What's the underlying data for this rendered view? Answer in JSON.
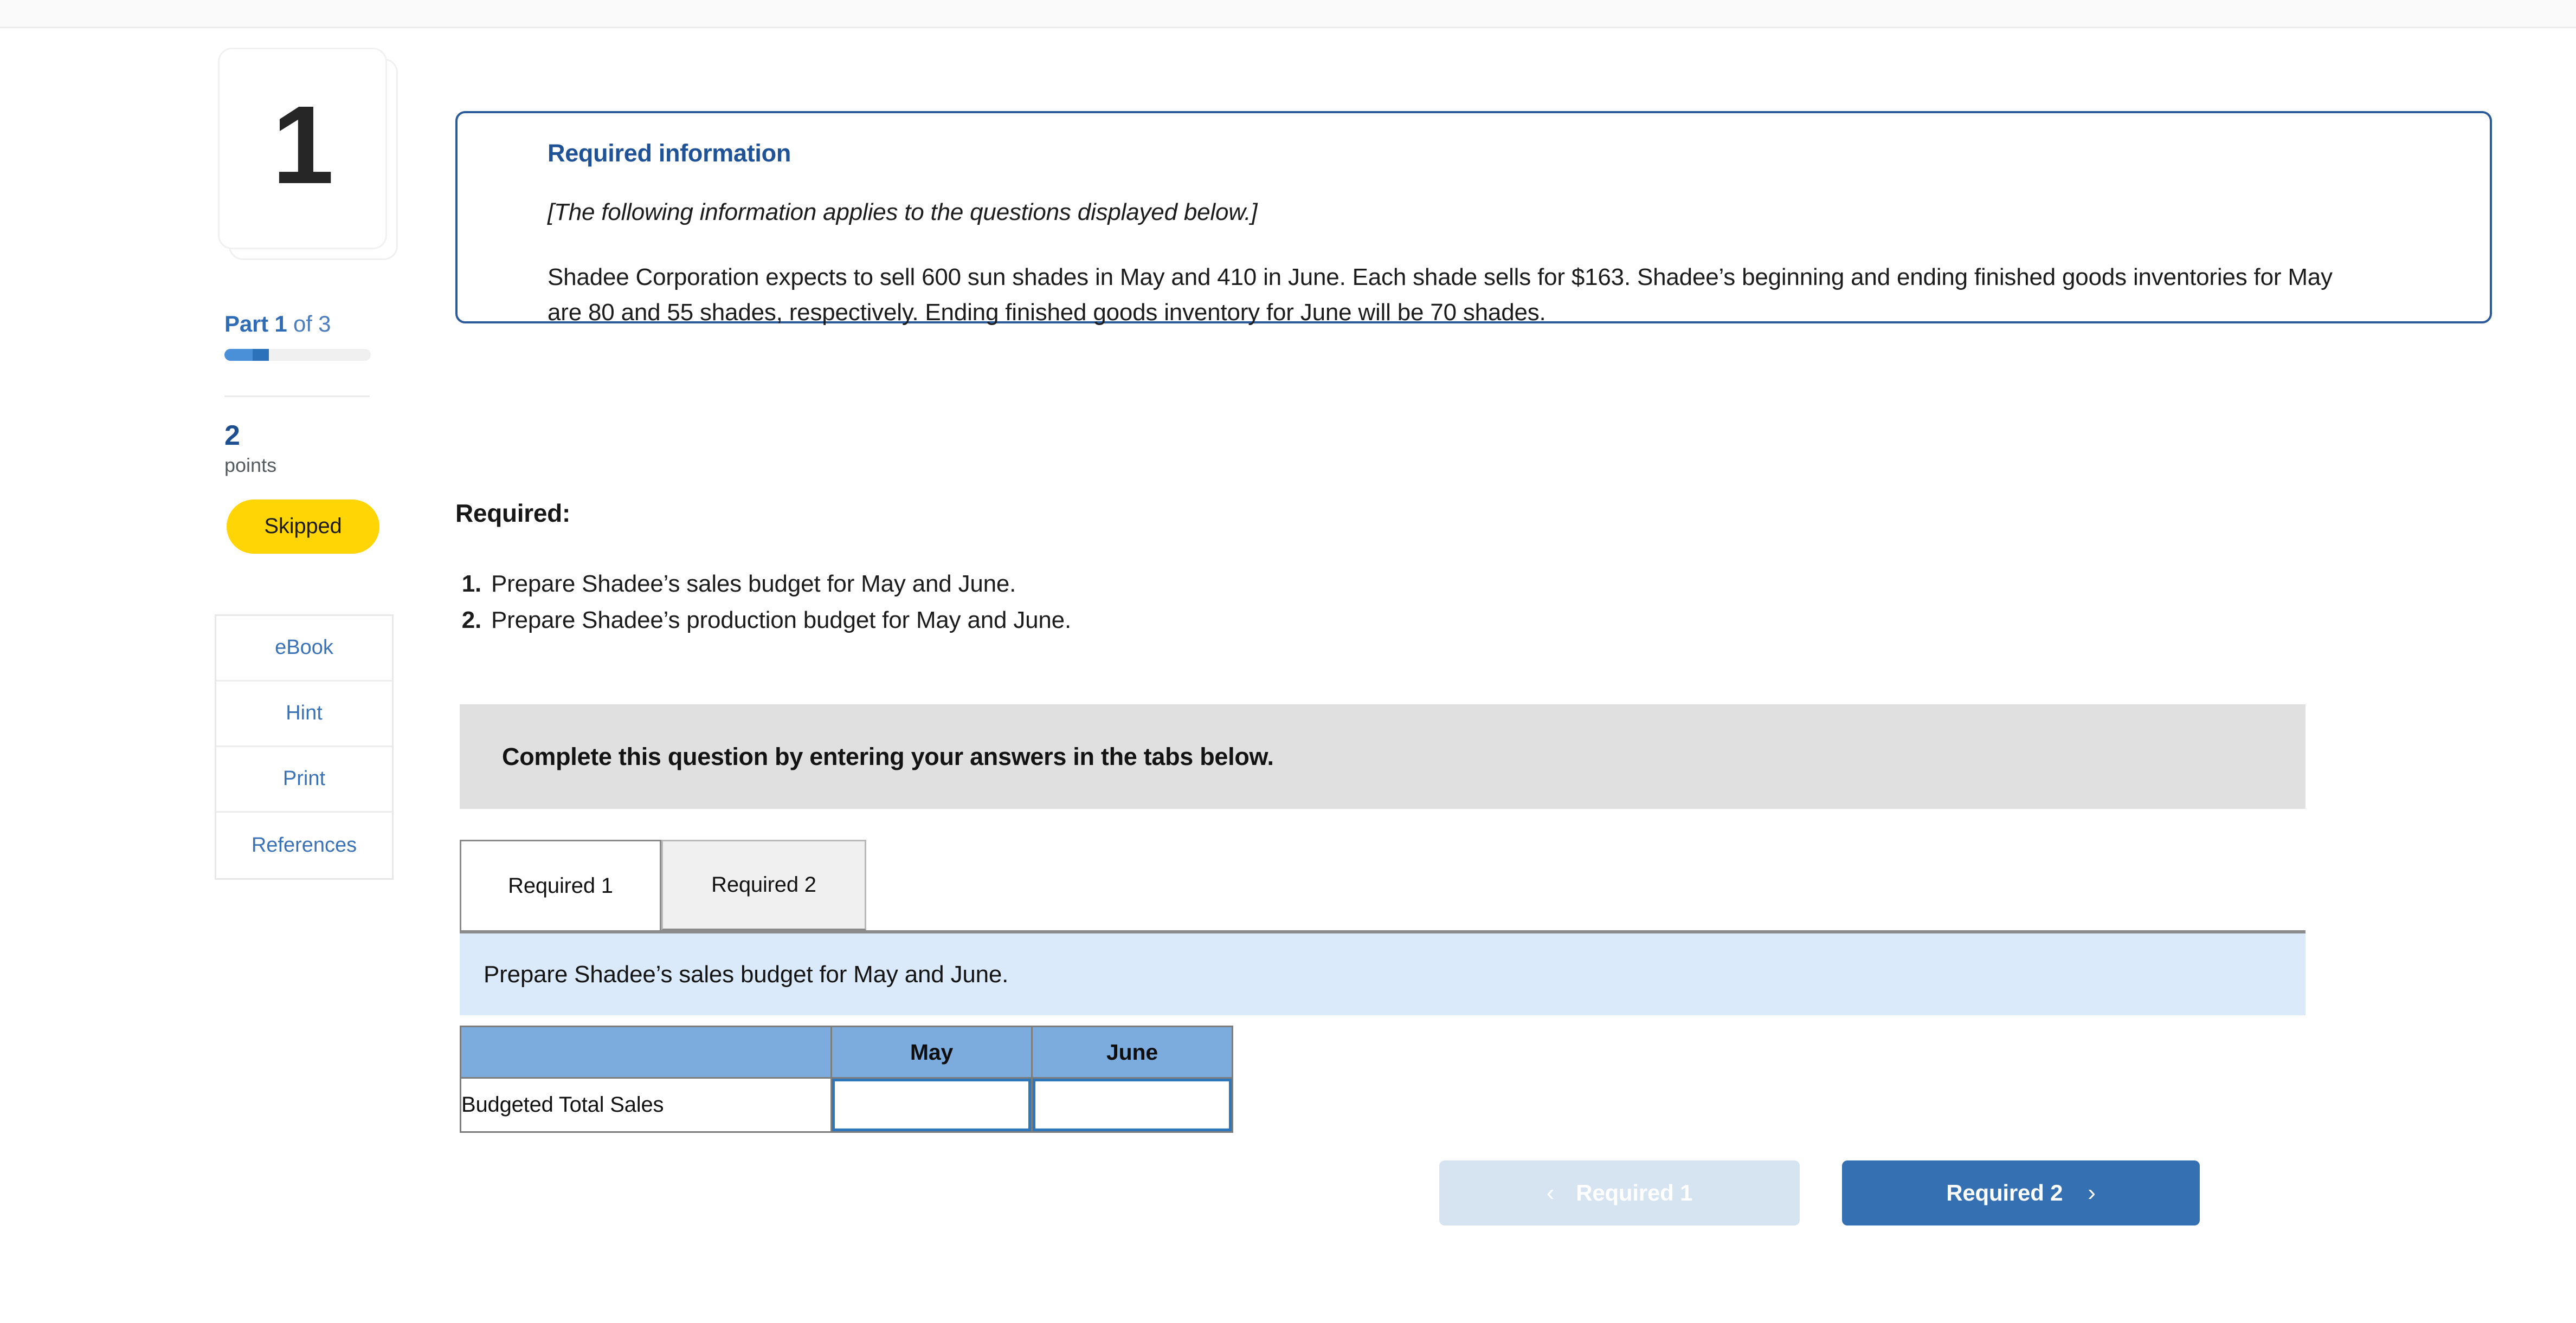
{
  "sidebar": {
    "card_number": "1",
    "part_label_prefix": "Part",
    "part_number": "1",
    "part_of": "of 3",
    "points_value": "2",
    "points_word": "points",
    "status_badge": "Skipped",
    "links": [
      {
        "label": "eBook"
      },
      {
        "label": "Hint"
      },
      {
        "label": "Print"
      },
      {
        "label": "References"
      }
    ],
    "progress_percent": 30
  },
  "info_box": {
    "title": "Required information",
    "note": "[The following information applies to the questions displayed below.]",
    "body": "Shadee Corporation expects to sell 600 sun shades in May and 410 in June. Each shade sells for $163. Shadee’s beginning and ending finished goods inventories for May are 80 and 55 shades, respectively. Ending finished goods inventory for June will be 70 shades."
  },
  "required": {
    "heading": "Required:",
    "items": [
      {
        "num": "1.",
        "text": "Prepare Shadee’s sales budget for May and June."
      },
      {
        "num": "2.",
        "text": "Prepare Shadee’s production budget for May and June."
      }
    ]
  },
  "instruction_bar": {
    "text": "Complete this question by entering your answers in the tabs below."
  },
  "tabs": [
    {
      "label": "Required 1",
      "active": true
    },
    {
      "label": "Required 2",
      "active": false
    }
  ],
  "tab_panel": {
    "subheader": "Prepare Shadee’s sales budget for May and June.",
    "table": {
      "columns": [
        "",
        "May",
        "June"
      ],
      "rows": [
        {
          "label": "Budgeted Total Sales",
          "may": "",
          "june": ""
        }
      ]
    }
  },
  "nav": {
    "prev_label": "Required 1",
    "prev_icon": "chevron-left-icon",
    "next_label": "Required 2",
    "next_icon": "chevron-right-icon"
  },
  "colors": {
    "accent_blue": "#3570b2",
    "info_border": "#2b5b9b",
    "badge_yellow": "#ffd505",
    "table_header_blue": "#7cacde",
    "subbar_blue": "#dbeafb",
    "instruction_gray": "#e0e0e0"
  }
}
